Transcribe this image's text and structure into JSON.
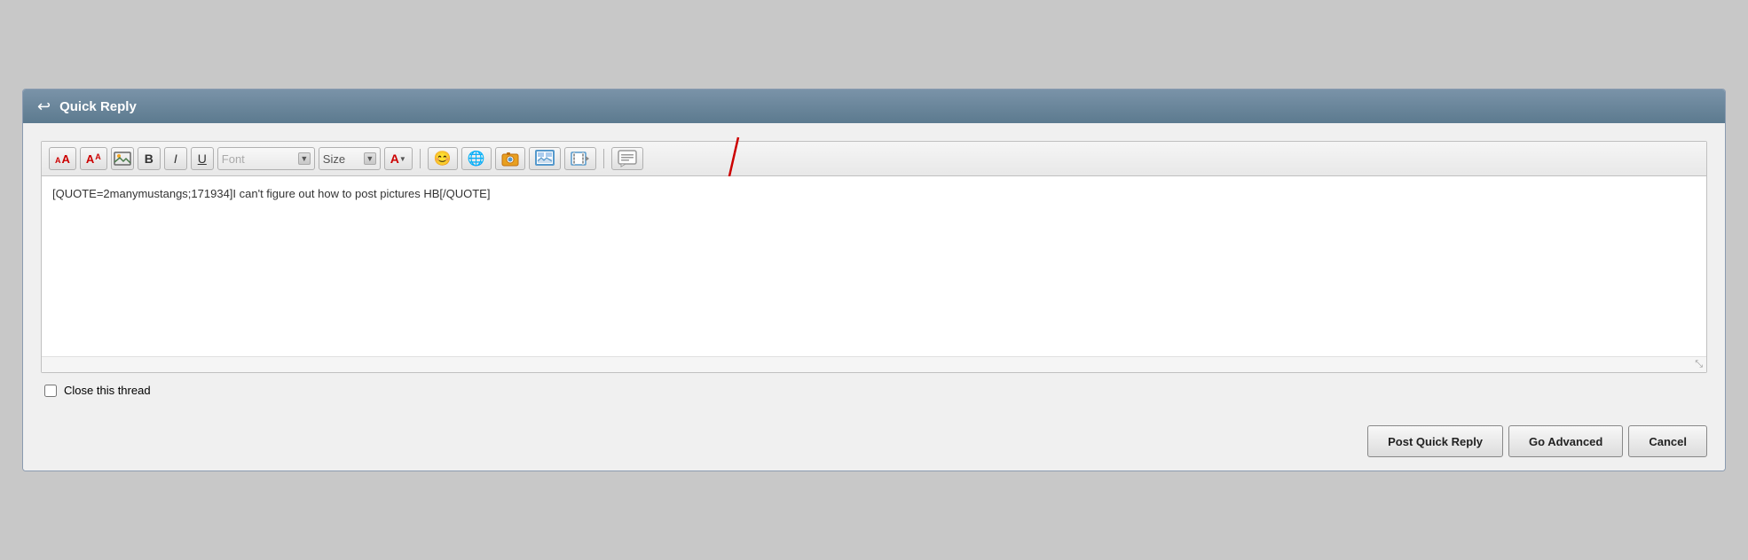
{
  "header": {
    "title": "Quick Reply",
    "back_icon": "↩"
  },
  "toolbar": {
    "font_placeholder": "Font",
    "size_label": "Size",
    "buttons": [
      {
        "id": "decrease-font",
        "label": "A",
        "sub": "A",
        "title": "Decrease Font Size"
      },
      {
        "id": "increase-font",
        "label": "A",
        "title": "Increase Font Size"
      },
      {
        "id": "insert-image",
        "label": "🖼",
        "title": "Insert Image"
      },
      {
        "id": "bold",
        "label": "B",
        "title": "Bold"
      },
      {
        "id": "italic",
        "label": "I",
        "title": "Italic"
      },
      {
        "id": "underline",
        "label": "U",
        "title": "Underline"
      }
    ],
    "right_buttons": [
      {
        "id": "smiley",
        "label": "😊",
        "title": "Insert Smiley"
      },
      {
        "id": "globe",
        "label": "🌐",
        "title": "Insert Link"
      },
      {
        "id": "image2",
        "label": "🎨",
        "title": "Insert Image"
      },
      {
        "id": "video",
        "label": "📷",
        "title": "Insert Video"
      },
      {
        "id": "film",
        "label": "🎬",
        "title": "Insert Film"
      },
      {
        "id": "speech",
        "label": "💬",
        "title": "Insert Quote"
      }
    ]
  },
  "editor": {
    "content": "[QUOTE=2manymustangs;171934]I can't figure out how to post pictures HB[/QUOTE]",
    "resize_handle": "⤡"
  },
  "footer": {
    "checkbox_label": "Close this thread"
  },
  "buttons": {
    "post_quick_reply": "Post Quick Reply",
    "go_advanced": "Go Advanced",
    "cancel": "Cancel"
  }
}
